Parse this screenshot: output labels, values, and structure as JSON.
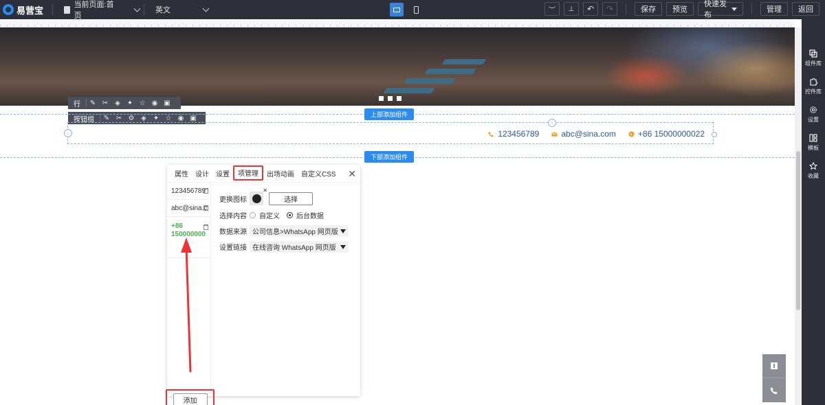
{
  "app": {
    "logo_text": "易营宝"
  },
  "topbar": {
    "current_page": "当前页面:首页",
    "language": "英文",
    "buttons": {
      "save": "保存",
      "preview": "预览",
      "publish": "快速发布",
      "manage": "管理",
      "back": "返回"
    }
  },
  "sidebar": {
    "items": [
      {
        "label": "组件库",
        "icon": "layers-icon"
      },
      {
        "label": "控件库",
        "icon": "puzzle-icon"
      },
      {
        "label": "设置",
        "icon": "gear-icon"
      },
      {
        "label": "模板",
        "icon": "template-icon"
      },
      {
        "label": "收藏",
        "icon": "star-icon"
      }
    ]
  },
  "canvas": {
    "row_toolbar_label": "行",
    "button_group_toolbar_label": "按钮组",
    "add_top": "上部添加组件",
    "add_bottom": "下部添加组件",
    "contacts": [
      {
        "icon": "phone-icon",
        "text": "123456789",
        "color": "#f0a030"
      },
      {
        "icon": "email-icon",
        "text": "abc@sina.com",
        "color": "#f0a030"
      },
      {
        "icon": "whatsapp-icon",
        "text": "+86 15000000022",
        "color": "#f0a030"
      }
    ]
  },
  "panel": {
    "tabs": [
      "属性",
      "设计",
      "设置",
      "项管理",
      "出场动画",
      "自定义CSS"
    ],
    "active_tab": "项管理",
    "items": [
      "123456789",
      "abc@sina.c",
      "+86 150000000"
    ],
    "add_button": "添加",
    "form": {
      "change_icon_label": "更换图标",
      "choose_button": "选择",
      "content_label": "选择内容",
      "content_options": [
        "自定义",
        "后台数据"
      ],
      "content_selected": "后台数据",
      "source_label": "数据来源",
      "source_value": "公司信息>WhatsApp 网页版",
      "link_label": "设置链接",
      "link_value": "在线咨询 WhatsApp 网页版"
    }
  },
  "colors": {
    "accent": "#2a8cf0",
    "highlight": "#e33333",
    "topbar_bg": "#2b303b"
  }
}
